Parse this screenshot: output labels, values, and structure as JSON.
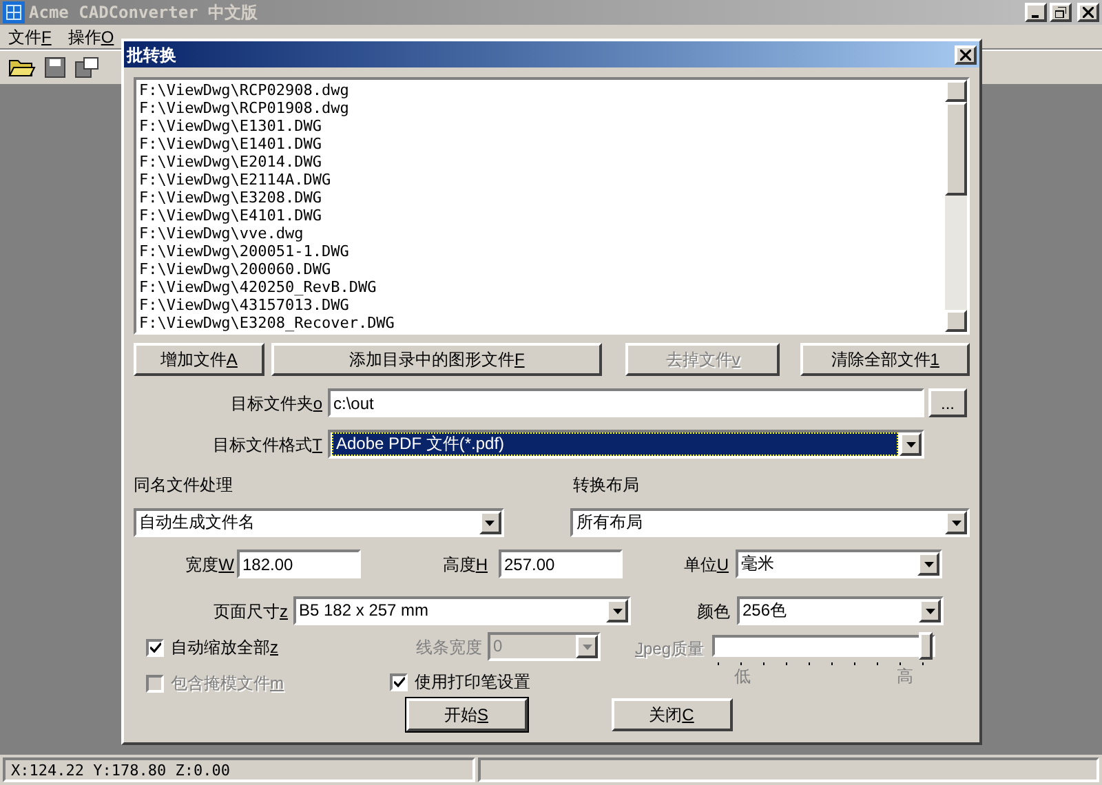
{
  "app": {
    "title": "Acme CADConverter 中文版",
    "menu": [
      {
        "label": "文件",
        "accel": "F"
      },
      {
        "label": "操作",
        "accel": "O"
      }
    ]
  },
  "dialog": {
    "title": "批转换",
    "files": [
      "F:\\ViewDwg\\RCP02908.dwg",
      "F:\\ViewDwg\\RCP01908.dwg",
      "F:\\ViewDwg\\E1301.DWG",
      "F:\\ViewDwg\\E1401.DWG",
      "F:\\ViewDwg\\E2014.DWG",
      "F:\\ViewDwg\\E2114A.DWG",
      "F:\\ViewDwg\\E3208.DWG",
      "F:\\ViewDwg\\E4101.DWG",
      "F:\\ViewDwg\\vve.dwg",
      "F:\\ViewDwg\\200051-1.DWG",
      "F:\\ViewDwg\\200060.DWG",
      "F:\\ViewDwg\\420250_RevB.DWG",
      "F:\\ViewDwg\\43157013.DWG",
      "F:\\ViewDwg\\E3208_Recover.DWG"
    ],
    "buttons": [
      {
        "label": "增加文件",
        "accel": "A",
        "disabled": false
      },
      {
        "label": "添加目录中的图形文件",
        "accel": "F",
        "disabled": false
      },
      {
        "label": "去掉文件",
        "accel": "v",
        "disabled": true
      },
      {
        "label": "清除全部文件",
        "accel": "1",
        "disabled": false
      }
    ],
    "target_folder": {
      "label": "目标文件夹",
      "accel": "o",
      "value": "c:\\out",
      "browse": "..."
    },
    "target_format": {
      "label": "目标文件格式",
      "accel": "T",
      "value": "Adobe PDF 文件(*.pdf)"
    },
    "same_name": {
      "label": "同名文件处理",
      "value": "自动生成文件名"
    },
    "layout": {
      "label": "转换布局",
      "value": "所有布局"
    },
    "width": {
      "label": "宽度",
      "accel": "W",
      "value": "182.00"
    },
    "height": {
      "label": "高度",
      "accel": "H",
      "value": "257.00"
    },
    "unit": {
      "label": "单位",
      "accel": "U",
      "value": "毫米"
    },
    "page_size": {
      "label": "页面尺寸",
      "accel": "z",
      "value": "B5 182 x 257 mm"
    },
    "color": {
      "label": "颜色",
      "value": "256色"
    },
    "auto_scale": {
      "label": "自动缩放全部",
      "accel": "z",
      "checked": true,
      "disabled": false
    },
    "line_width": {
      "label": "线条宽度",
      "value": "0",
      "disabled": true
    },
    "jpeg": {
      "label": "peg质量",
      "accel": "J",
      "accel_first": true,
      "disabled": true,
      "level": 1,
      "low": "低",
      "high": "高"
    },
    "include_mask": {
      "label": "包含掩模文件",
      "accel": "m",
      "checked": false,
      "disabled": true
    },
    "use_pen": {
      "label": "使用打印笔设置",
      "checked": true,
      "disabled": false
    },
    "actions": [
      {
        "label": "开始",
        "accel": "S",
        "default": true
      },
      {
        "label": "关闭",
        "accel": "C",
        "default": false
      }
    ]
  },
  "status_bar": [
    "X:124.22 Y:178.80 Z:0.00"
  ]
}
